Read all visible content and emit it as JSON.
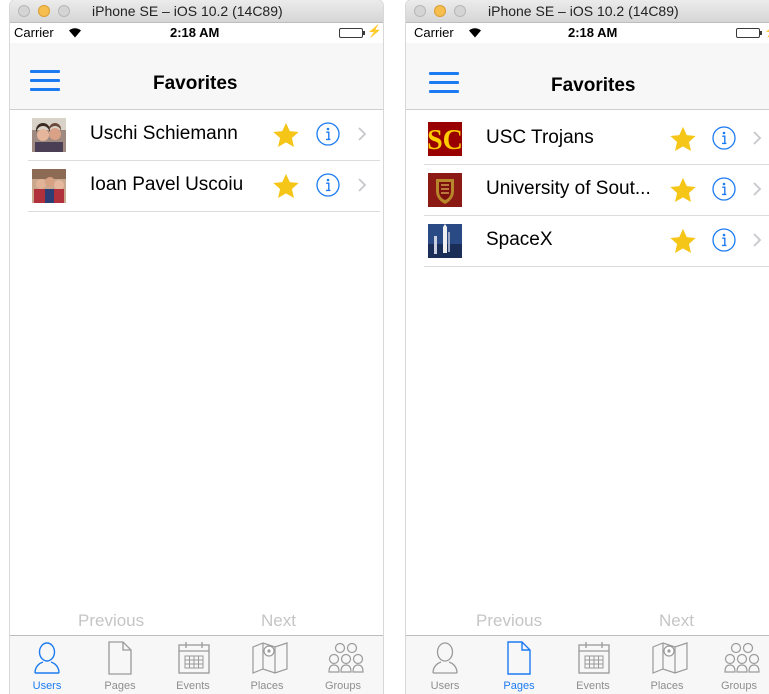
{
  "colors": {
    "accent": "#1d7bf2",
    "star": "#f5c518",
    "inactive_tab": "#8e8e8e",
    "pager_disabled": "#c5c5c5",
    "battery": "#4cd964"
  },
  "left_screen": {
    "window_title": "iPhone SE – iOS 10.2 (14C89)",
    "status": {
      "carrier": "Carrier",
      "time": "2:18 AM"
    },
    "nav_title": "Favorites",
    "rows": [
      {
        "label": "Uschi Schiemann",
        "thumb": "photo-couple",
        "favorite": true
      },
      {
        "label": "Ioan Pavel Uscoiu",
        "thumb": "photo-group",
        "favorite": true
      }
    ],
    "pager": {
      "previous": "Previous",
      "next": "Next"
    },
    "tabs": [
      {
        "label": "Users",
        "icon": "user-icon",
        "active": true
      },
      {
        "label": "Pages",
        "icon": "page-icon",
        "active": false
      },
      {
        "label": "Events",
        "icon": "calendar-icon",
        "active": false
      },
      {
        "label": "Places",
        "icon": "map-icon",
        "active": false
      },
      {
        "label": "Groups",
        "icon": "group-icon",
        "active": false
      }
    ]
  },
  "right_screen": {
    "window_title": "iPhone SE – iOS 10.2 (14C89)",
    "status": {
      "carrier": "Carrier",
      "time": "2:18 AM"
    },
    "nav_title": "Favorites",
    "rows": [
      {
        "label": "USC Trojans",
        "thumb": "usc-sc-logo",
        "favorite": true
      },
      {
        "label": "University of Sout...",
        "thumb": "usc-seal-logo",
        "favorite": true
      },
      {
        "label": "SpaceX",
        "thumb": "spacex-photo",
        "favorite": true
      }
    ],
    "pager": {
      "previous": "Previous",
      "next": "Next"
    },
    "tabs": [
      {
        "label": "Users",
        "icon": "user-icon",
        "active": false
      },
      {
        "label": "Pages",
        "icon": "page-icon",
        "active": true
      },
      {
        "label": "Events",
        "icon": "calendar-icon",
        "active": false
      },
      {
        "label": "Places",
        "icon": "map-icon",
        "active": false
      },
      {
        "label": "Groups",
        "icon": "group-icon",
        "active": false
      }
    ]
  }
}
